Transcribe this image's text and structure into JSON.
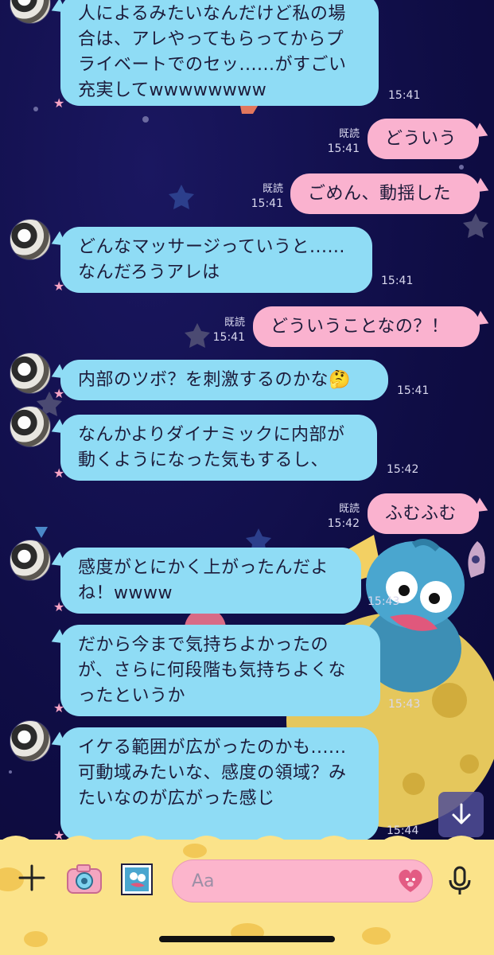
{
  "messages": [
    {
      "side": "in",
      "text": "人によるみたいなんだけど私の場合は、アレやってもらってからプライベートでのセッ......がすごい充実してwwwwwwww",
      "time": "15:41"
    },
    {
      "side": "out",
      "text": "どういう",
      "time": "15:41",
      "read": "既読"
    },
    {
      "side": "out",
      "text": "ごめん、動揺した",
      "time": "15:41",
      "read": "既読"
    },
    {
      "side": "in",
      "text": "どんなマッサージっていうと......なんだろうアレは",
      "time": "15:41"
    },
    {
      "side": "out",
      "text": "どういうことなの？！",
      "time": "15:41",
      "read": "既読"
    },
    {
      "side": "in",
      "text": "内部のツボ？を刺激するのかな🤔",
      "time": "15:41"
    },
    {
      "side": "in",
      "text": "なんかよりダイナミックに内部が動くようになった気もするし、",
      "time": "15:42"
    },
    {
      "side": "out",
      "text": "ふむふむ",
      "time": "15:42",
      "read": "既読"
    },
    {
      "side": "in",
      "text": "感度がとにかく上がったんだよね！wwww",
      "time": "15:43"
    },
    {
      "side": "in",
      "text": "だから今まで気持ちよかったのが、さらに何段階も気持ちよくなったというか",
      "time": "15:43"
    },
    {
      "side": "in",
      "text": "イケる範囲が広がったのかも......可動域みたいな、感度の領域？みたいなのが広がった感じ",
      "time": "15:44"
    }
  ],
  "input": {
    "placeholder": "Aa"
  },
  "icons": {
    "scroll_down": "arrow-down-icon",
    "plus": "plus-icon",
    "camera": "camera-icon",
    "gallery": "gallery-icon",
    "emoji": "emoji-icon",
    "mic": "mic-icon"
  },
  "colors": {
    "incoming_bubble": "#8fdcf5",
    "outgoing_bubble": "#fab2cf",
    "background": "#12104a",
    "bottom_bar": "#fbe38a"
  }
}
